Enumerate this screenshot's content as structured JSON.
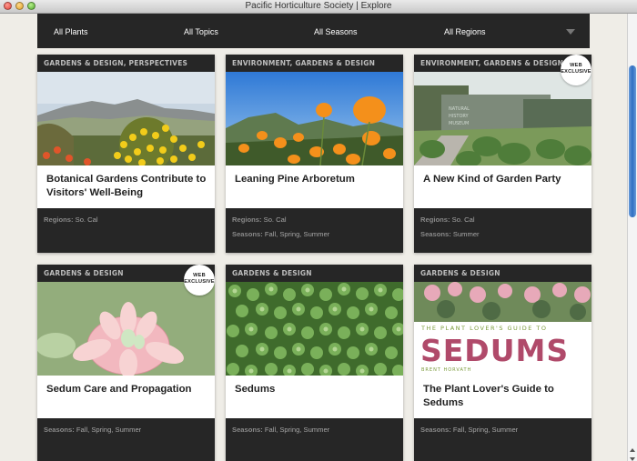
{
  "window": {
    "title": "Pacific Horticulture Society | Explore"
  },
  "filters": [
    {
      "label": "All Plants"
    },
    {
      "label": "All Topics"
    },
    {
      "label": "All Seasons"
    },
    {
      "label": "All Regions"
    }
  ],
  "cards": [
    {
      "category": "Gardens & Design, Perspectives",
      "title": "Botanical Gardens Contribute to Visitors' Well-Being",
      "regions_label": "Regions:",
      "regions": "So. Cal",
      "seasons_label": "",
      "seasons": "",
      "badge": ""
    },
    {
      "category": "Environment, Gardens & Design",
      "title": "Leaning Pine Arboretum",
      "regions_label": "Regions:",
      "regions": "So. Cal",
      "seasons_label": "Seasons:",
      "seasons": "Fall, Spring, Summer",
      "badge": ""
    },
    {
      "category": "Environment, Gardens & Design",
      "title": "A New Kind of Garden Party",
      "regions_label": "Regions:",
      "regions": "So. Cal",
      "seasons_label": "Seasons:",
      "seasons": "Summer",
      "badge": "WEB EXCLUSIVE"
    },
    {
      "category": "Gardens & Design",
      "title": "Sedum Care and Propagation",
      "regions_label": "",
      "regions": "",
      "seasons_label": "Seasons:",
      "seasons": "Fall, Spring, Summer",
      "badge": "WEB EXCLUSIVE"
    },
    {
      "category": "Gardens & Design",
      "title": "Sedums",
      "regions_label": "",
      "regions": "",
      "seasons_label": "Seasons:",
      "seasons": "Fall, Spring, Summer",
      "badge": ""
    },
    {
      "category": "Gardens & Design",
      "title": "The Plant Lover's Guide to Sedums",
      "regions_label": "",
      "regions": "",
      "seasons_label": "Seasons:",
      "seasons": "Fall, Spring, Summer",
      "badge": ""
    }
  ],
  "book_cover": {
    "kicker": "THE PLANT LOVER'S GUIDE TO",
    "title": "SEDUMS",
    "author": "BRENT HORVATH"
  },
  "museum_sign": {
    "line1": "NATURAL",
    "line2": "HISTORY",
    "line3": "MUSEUM"
  },
  "colors": {
    "bar": "#262626",
    "meta_text": "#a6a6a6",
    "card_title": "#222222",
    "scroll_thumb": "#2f6fc2"
  }
}
